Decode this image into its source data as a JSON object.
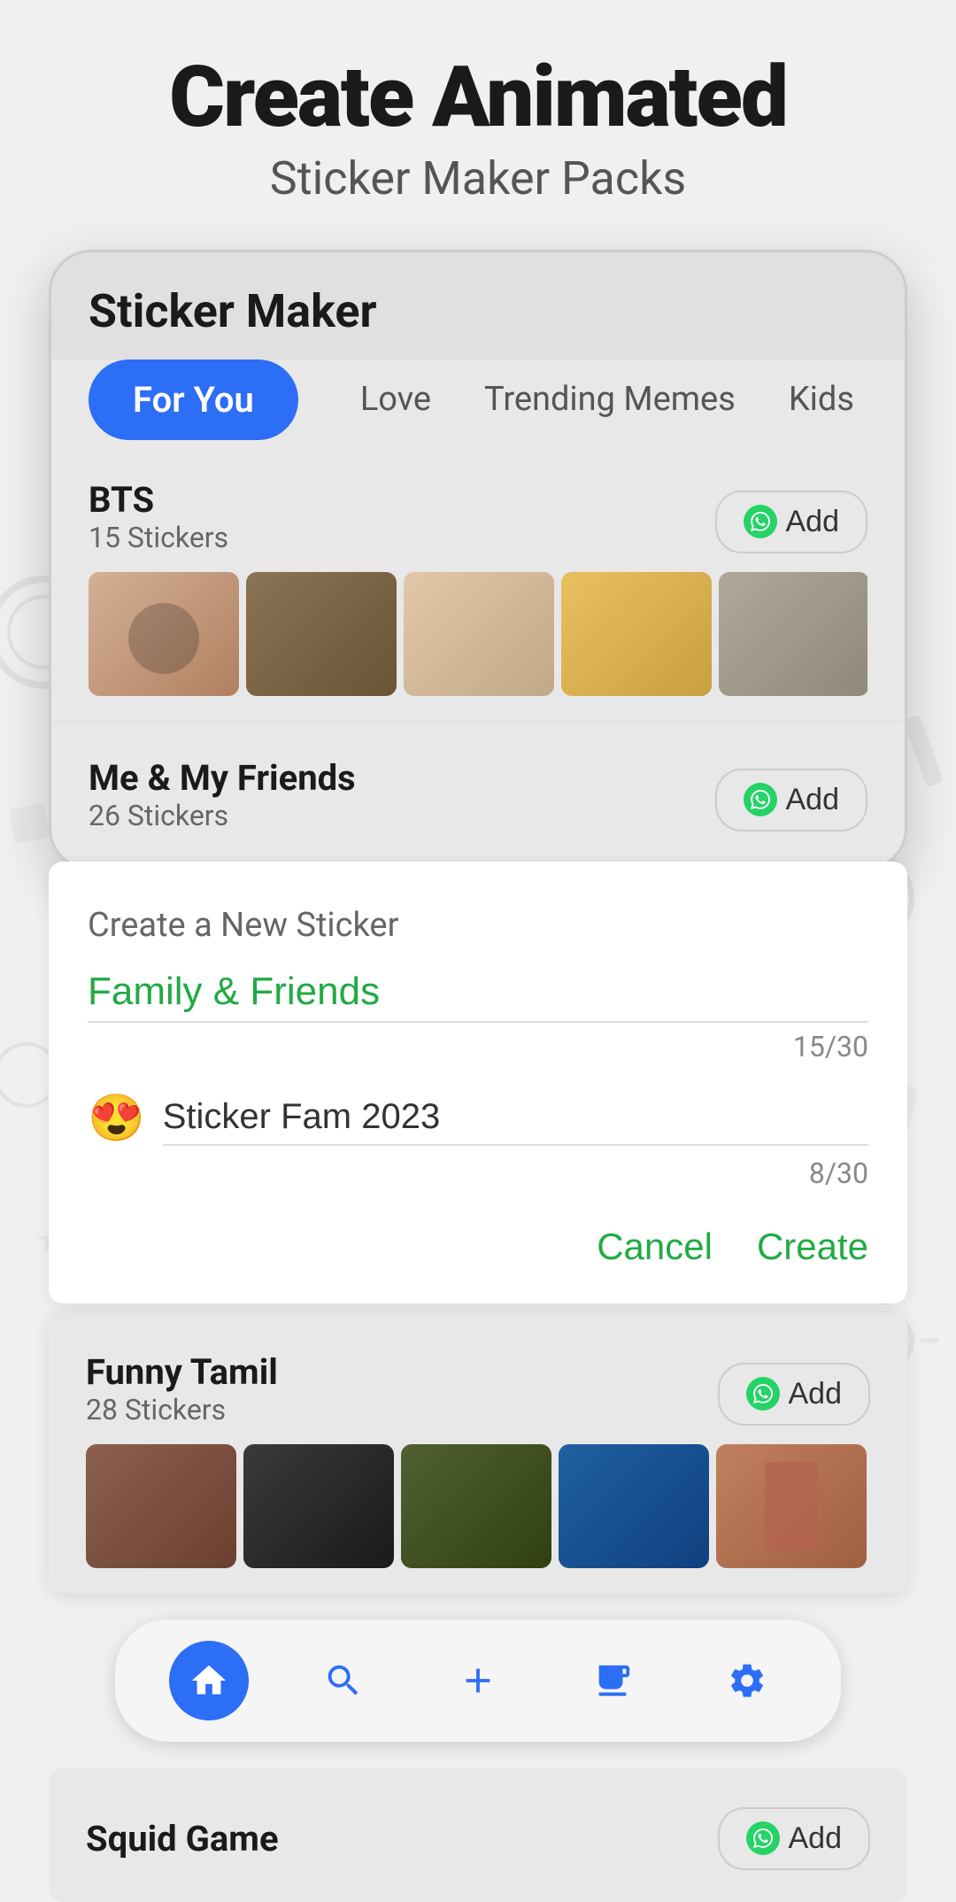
{
  "header": {
    "title_line1": "Create Animated",
    "title_line2": "Sticker Maker Packs"
  },
  "phone": {
    "app_title": "Sticker Maker",
    "tabs": [
      {
        "label": "For You",
        "active": true
      },
      {
        "label": "Love",
        "active": false
      },
      {
        "label": "Trending Memes",
        "active": false
      },
      {
        "label": "Kids",
        "active": false
      }
    ],
    "sticker_packs": [
      {
        "name": "BTS",
        "count": "15 Stickers",
        "add_label": "Add"
      },
      {
        "name": "Me & My Friends",
        "count": "26 Stickers",
        "add_label": "Add"
      }
    ]
  },
  "create_section": {
    "title": "Create a New Sticker",
    "pack_name_value": "Family & Friends",
    "pack_name_placeholder": "Family & Friends",
    "pack_name_count": "15/30",
    "emoji": "😍",
    "sticker_pack_value": "Sticker Fam 2023",
    "sticker_pack_placeholder": "Sticker Fam 2023",
    "sticker_pack_count": "8/30",
    "cancel_label": "Cancel",
    "create_label": "Create"
  },
  "funny_tamil": {
    "name": "Funny Tamil",
    "count": "28 Stickers",
    "add_label": "Add"
  },
  "squid_game": {
    "name": "Squid Game",
    "add_label": "Add"
  },
  "bottom_nav": {
    "items": [
      {
        "icon": "🏠",
        "label": "home",
        "active": true
      },
      {
        "icon": "🔍",
        "label": "search",
        "active": false
      },
      {
        "icon": "➕",
        "label": "add",
        "active": false
      },
      {
        "icon": "📋",
        "label": "packs",
        "active": false
      },
      {
        "icon": "⚙️",
        "label": "settings",
        "active": false
      }
    ]
  },
  "icons": {
    "whatsapp": "✓",
    "home": "🏠",
    "search": "🔍",
    "add": "➕",
    "packs": "📋",
    "settings": "⚙️"
  }
}
